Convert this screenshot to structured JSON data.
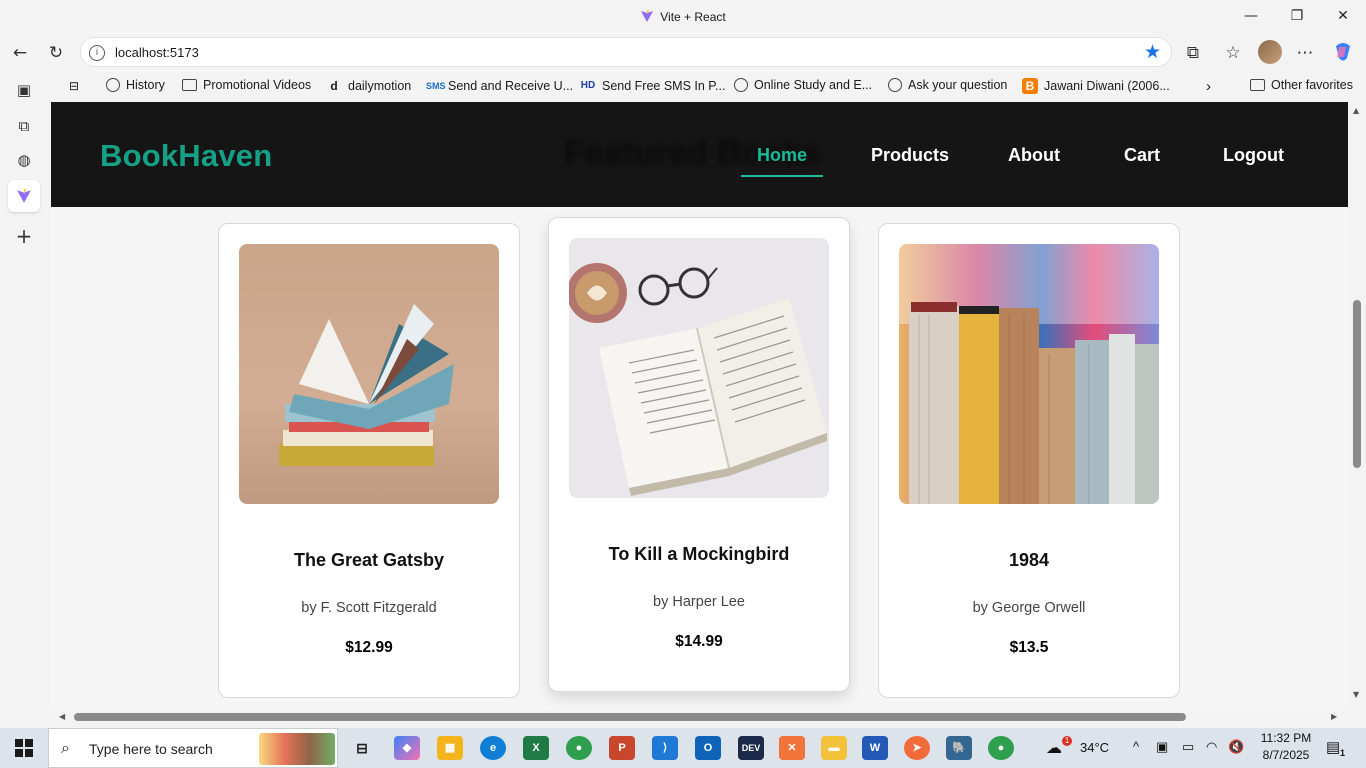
{
  "window": {
    "title": "Vite + React"
  },
  "browser": {
    "url": "localhost:5173",
    "favorites": [
      {
        "label": "History",
        "icon": "globe-icon"
      },
      {
        "label": "Promotional Videos",
        "icon": "folder-icon"
      },
      {
        "label": "dailymotion",
        "icon": "dailymotion-icon"
      },
      {
        "label": "Send and Receive U...",
        "icon": "sms-icon"
      },
      {
        "label": "Send Free SMS In P...",
        "icon": "hd-icon"
      },
      {
        "label": "Online Study and E...",
        "icon": "globe-icon"
      },
      {
        "label": "Ask your question",
        "icon": "globe-icon"
      },
      {
        "label": "Jawani Diwani (2006...",
        "icon": "blogger-icon"
      }
    ],
    "other_favorites": "Other favorites"
  },
  "site": {
    "brand": "BookHaven",
    "ghost_heading": "Featured Books",
    "nav": [
      "Home",
      "Products",
      "About",
      "Cart",
      "Logout"
    ],
    "active_nav": "Home",
    "brand_color": "#16a085",
    "books": [
      {
        "title": "The Great Gatsby",
        "author": "by F. Scott Fitzgerald",
        "price": "$12.99"
      },
      {
        "title": "To Kill a Mockingbird",
        "author": "by Harper Lee",
        "price": "$14.99"
      },
      {
        "title": "1984",
        "author": "by George Orwell",
        "price": "$13.5"
      }
    ]
  },
  "taskbar": {
    "search_placeholder": "Type here to search",
    "weather": "34°C",
    "weather_badge": "1",
    "time": "11:32 PM",
    "date": "8/7/2025",
    "notification_count": "1"
  }
}
